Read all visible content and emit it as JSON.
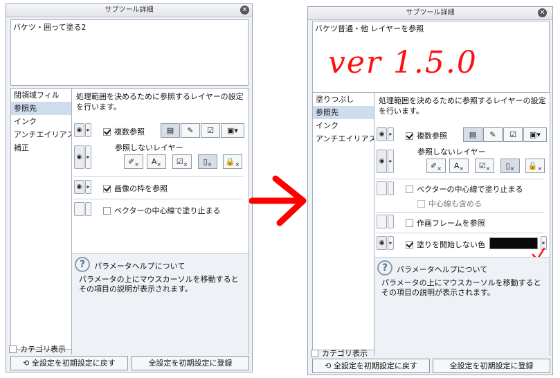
{
  "left": {
    "title": "サブツール詳細",
    "close": "✕",
    "tool_name": "バケツ・囲って塗る2",
    "categories": [
      "閉領域フィル",
      "参照先",
      "インク",
      "アンチエイリアス",
      "補正"
    ],
    "description": "処理範囲を決めるために参照するレイヤーの設定を行います。",
    "multi_ref_label": "複数参照",
    "exclude_layers_label": "参照しないレイヤー",
    "image_frame_label": "画像の枠を参照",
    "vector_center_label": "ベクターの中心線で塗り止まる",
    "hint_title": "パラメータヘルプについて",
    "hint_text": "パラメータの上にマウスカーソルを移動するとその項目の説明が表示されます。",
    "category_toggle": "カテゴリ表示",
    "reset_button": "全設定を初期設定に戻す",
    "register_button": "全設定を初期設定に登録"
  },
  "right": {
    "title": "サブツール詳細",
    "close": "✕",
    "tool_name": "バケツ普通・他 レイヤーを参照",
    "version_annotation": "ver 1.5.0",
    "categories": [
      "塗りつぶし",
      "参照先",
      "インク",
      "アンチエイリアス"
    ],
    "description": "処理範囲を決めるために参照するレイヤーの設定を行います。",
    "multi_ref_label": "複数参照",
    "exclude_layers_label": "参照しないレイヤー",
    "vector_center_label": "ベクターの中心線で塗り止まる",
    "include_center_label": "中心線も含める",
    "frame_label": "作画フレームを参照",
    "no_fill_color_label": "塗りを開始しない色",
    "no_fill_color": "#0a0a0a",
    "hint_title": "パラメータヘルプについて",
    "hint_text": "パラメータの上にマウスカーソルを移動するとその項目の説明が表示されます。",
    "category_toggle": "カテゴリ表示",
    "reset_button": "全設定を初期設定に戻す",
    "register_button": "全設定を初期設定に登録"
  },
  "icons": {
    "eye": "◉",
    "arrow": "▸",
    "help": "?",
    "reset": "⟲"
  }
}
